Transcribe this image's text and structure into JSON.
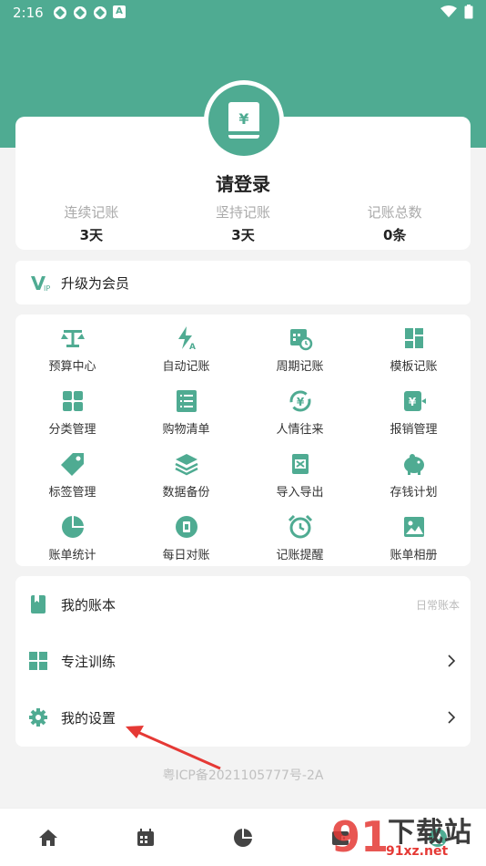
{
  "status_bar": {
    "time": "2:16",
    "notification_glyph": "A"
  },
  "profile": {
    "login_text": "请登录",
    "book_symbol": "¥"
  },
  "stats": [
    {
      "label": "连续记账",
      "value": "3天"
    },
    {
      "label": "坚持记账",
      "value": "3天"
    },
    {
      "label": "记账总数",
      "value": "0条"
    }
  ],
  "vip": {
    "label": "升级为会员"
  },
  "grid": [
    {
      "label": "预算中心",
      "icon": "scale-icon"
    },
    {
      "label": "自动记账",
      "icon": "lightning-icon"
    },
    {
      "label": "周期记账",
      "icon": "calendar-cycle-icon"
    },
    {
      "label": "模板记账",
      "icon": "template-icon"
    },
    {
      "label": "分类管理",
      "icon": "category-icon"
    },
    {
      "label": "购物清单",
      "icon": "list-icon"
    },
    {
      "label": "人情往来",
      "icon": "exchange-icon"
    },
    {
      "label": "报销管理",
      "icon": "reimburse-icon"
    },
    {
      "label": "标签管理",
      "icon": "tag-icon"
    },
    {
      "label": "数据备份",
      "icon": "layers-icon"
    },
    {
      "label": "导入导出",
      "icon": "excel-icon"
    },
    {
      "label": "存钱计划",
      "icon": "piggy-bank-icon"
    },
    {
      "label": "账单统计",
      "icon": "pie-chart-icon"
    },
    {
      "label": "每日对账",
      "icon": "reconcile-icon"
    },
    {
      "label": "记账提醒",
      "icon": "alarm-clock-icon"
    },
    {
      "label": "账单相册",
      "icon": "image-icon"
    }
  ],
  "menu": {
    "books": {
      "label": "我的账本",
      "value": "日常账本"
    },
    "focus": {
      "label": "专注训练"
    },
    "settings": {
      "label": "我的设置"
    }
  },
  "icp": "粤ICP备2021105777号-2A",
  "watermark": {
    "text": "下载站",
    "url": "91xz.net"
  },
  "colors": {
    "primary": "#4fab92",
    "arrow": "#e53935"
  }
}
